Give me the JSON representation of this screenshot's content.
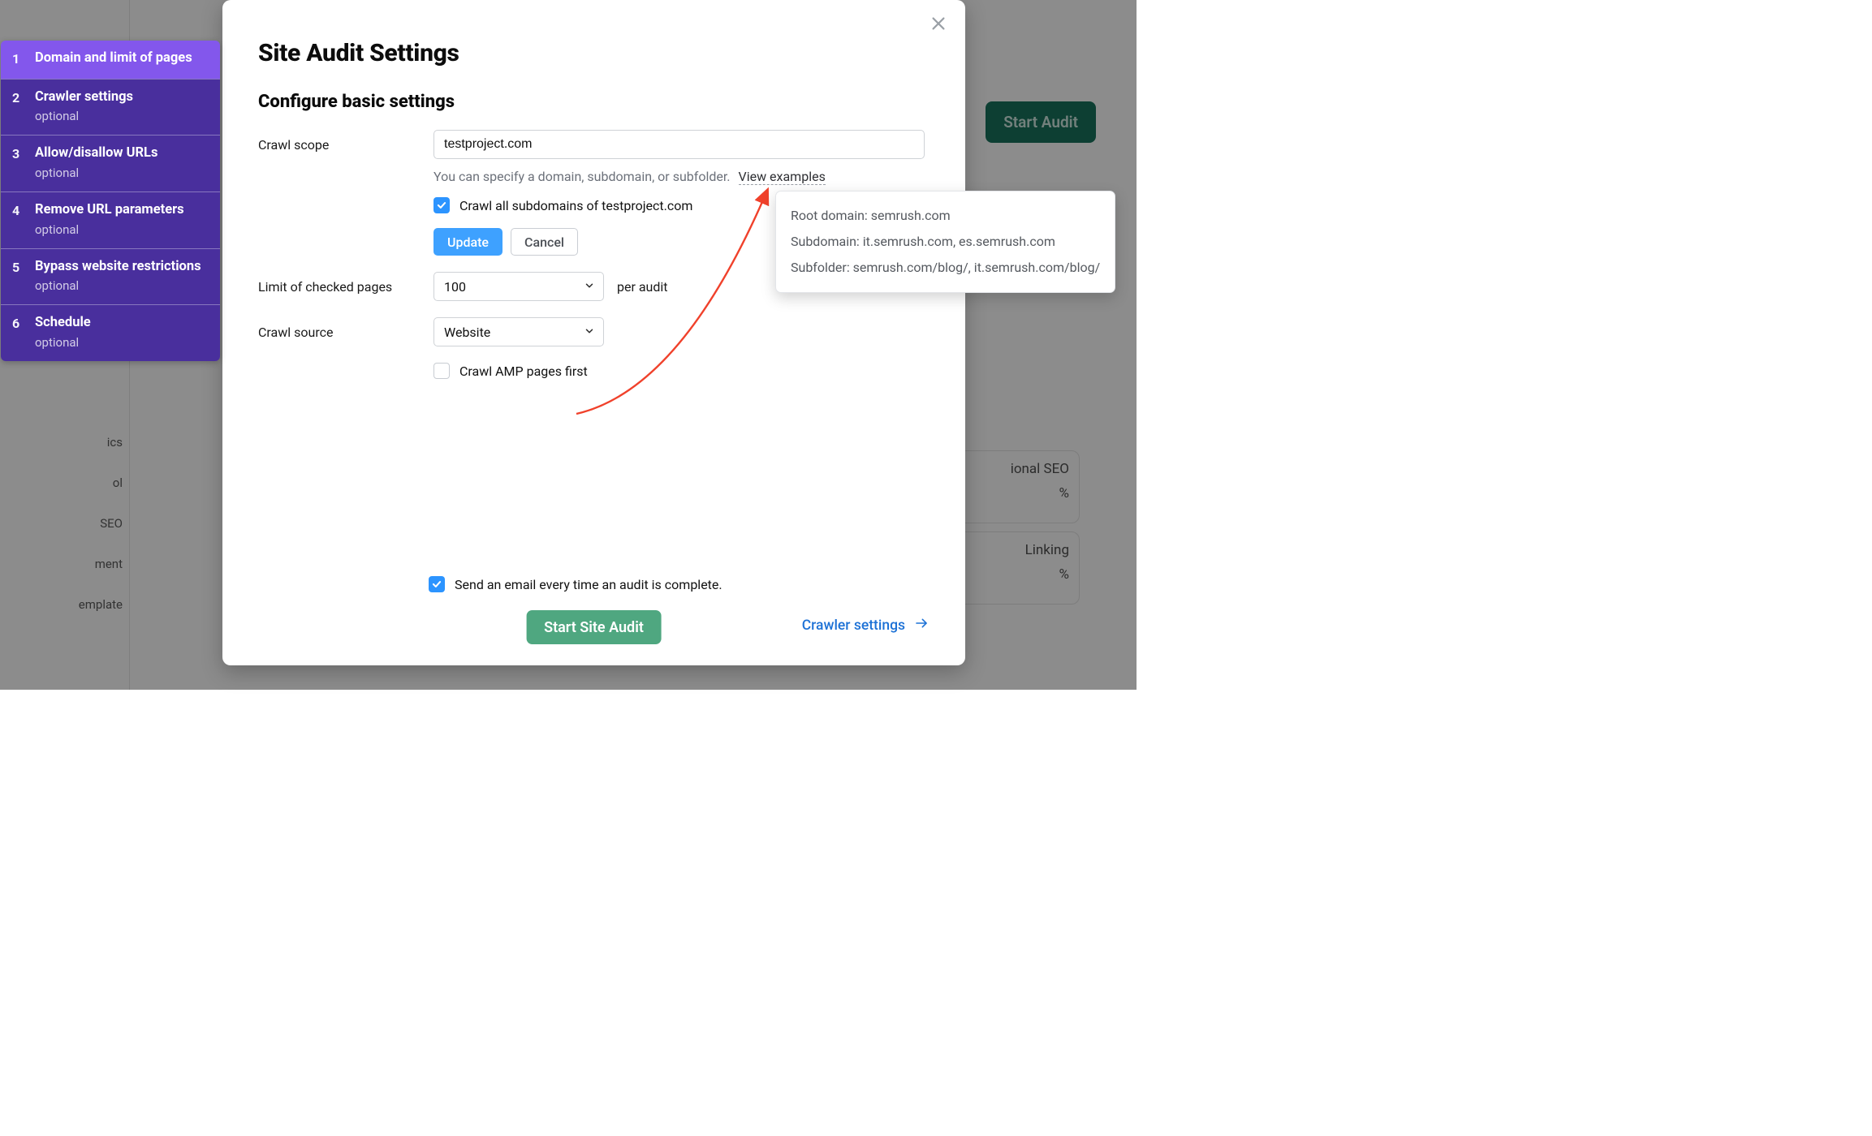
{
  "background": {
    "start_audit_btn": "Start Audit",
    "sidebar_items": [
      "ics",
      "ol",
      "SEO",
      "ment",
      "emplate"
    ],
    "card1_line1": "ional SEO",
    "card1_line2": "%",
    "card2_line1": "Linking",
    "card2_line2": "%"
  },
  "wizard": {
    "steps": [
      {
        "num": "1",
        "title": "Domain and limit of pages",
        "sub": ""
      },
      {
        "num": "2",
        "title": "Crawler settings",
        "sub": "optional"
      },
      {
        "num": "3",
        "title": "Allow/disallow URLs",
        "sub": "optional"
      },
      {
        "num": "4",
        "title": "Remove URL parameters",
        "sub": "optional"
      },
      {
        "num": "5",
        "title": "Bypass website restrictions",
        "sub": "optional"
      },
      {
        "num": "6",
        "title": "Schedule",
        "sub": "optional"
      }
    ]
  },
  "modal": {
    "title": "Site Audit Settings",
    "subtitle": "Configure basic settings",
    "labels": {
      "crawl_scope": "Crawl scope",
      "limit_pages": "Limit of checked pages",
      "crawl_source": "Crawl source"
    },
    "crawl_scope_value": "testproject.com",
    "crawl_scope_hint": "You can specify a domain, subdomain, or subfolder.",
    "view_examples": "View examples",
    "crawl_all_subdomains": "Crawl all subdomains of testproject.com",
    "update_btn": "Update",
    "cancel_btn": "Cancel",
    "limit_value": "100",
    "per_audit": "per audit",
    "crawl_source_value": "Website",
    "crawl_amp": "Crawl AMP pages first",
    "email_checkbox": "Send an email every time an audit is complete.",
    "start_btn": "Start Site Audit",
    "next_link": "Crawler settings"
  },
  "tooltip": {
    "line1": "Root domain: semrush.com",
    "line2": "Subdomain: it.semrush.com, es.semrush.com",
    "line3": "Subfolder: semrush.com/blog/, it.semrush.com/blog/"
  }
}
